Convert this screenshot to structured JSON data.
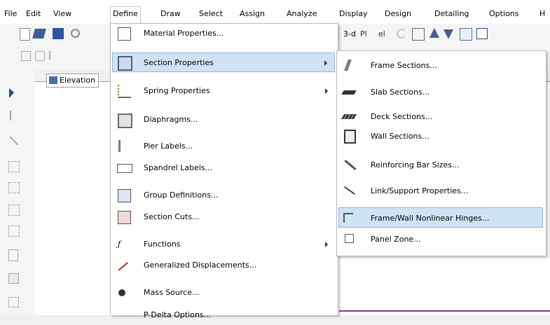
{
  "menubar": {
    "items": [
      {
        "label": "File"
      },
      {
        "label": "Edit"
      },
      {
        "label": "View"
      },
      {
        "label": "Define"
      },
      {
        "label": "Draw"
      },
      {
        "label": "Select"
      },
      {
        "label": "Assign"
      },
      {
        "label": "Analyze"
      },
      {
        "label": "Display"
      },
      {
        "label": "Design"
      },
      {
        "label": "Detailing"
      },
      {
        "label": "Options"
      },
      {
        "label": "H"
      }
    ],
    "active": "Define"
  },
  "toolbar": {
    "view_3d_label": "3-d",
    "plan_label": "Pl",
    "elev_label": "el"
  },
  "tab": {
    "label": "Elevation"
  },
  "define_menu": {
    "items": [
      {
        "label": "Material Properties...",
        "icon": "material-icon"
      },
      {
        "label": "Section Properties",
        "icon": "section-icon",
        "submenu": true
      },
      {
        "label": "Spring Properties",
        "icon": "spring-icon",
        "submenu": true
      },
      {
        "label": "Diaphragms...",
        "icon": "diaphragm-icon"
      },
      {
        "label": "Pier Labels...",
        "icon": "pier-icon"
      },
      {
        "label": "Spandrel Labels...",
        "icon": "spandrel-icon"
      },
      {
        "label": "Group Definitions...",
        "icon": "group-icon"
      },
      {
        "label": "Section Cuts...",
        "icon": "section-cut-icon"
      },
      {
        "label": "Functions",
        "icon": "function-icon",
        "submenu": true
      },
      {
        "label": "Generalized Displacements...",
        "icon": "displacement-icon"
      },
      {
        "label": "Mass Source...",
        "icon": "mass-icon"
      },
      {
        "label": "P-Delta Options...",
        "icon": "pdelta-icon"
      }
    ]
  },
  "section_submenu": {
    "items": [
      {
        "label": "Frame Sections...",
        "icon": "frame-section-icon"
      },
      {
        "label": "Slab Sections...",
        "icon": "slab-section-icon"
      },
      {
        "label": "Deck Sections...",
        "icon": "deck-section-icon"
      },
      {
        "label": "Wall Sections...",
        "icon": "wall-section-icon"
      },
      {
        "label": "Reinforcing Bar Sizes...",
        "icon": "rebar-icon"
      },
      {
        "label": "Link/Support Properties...",
        "icon": "link-icon"
      },
      {
        "label": "Frame/Wall Nonlinear Hinges...",
        "icon": "hinge-icon"
      },
      {
        "label": "Panel Zone...",
        "icon": "panel-zone-icon"
      }
    ]
  },
  "colors": {
    "highlight": "#cfe3f7",
    "highlight_border": "#8fb3dd",
    "accent": "#4b6fa8"
  }
}
